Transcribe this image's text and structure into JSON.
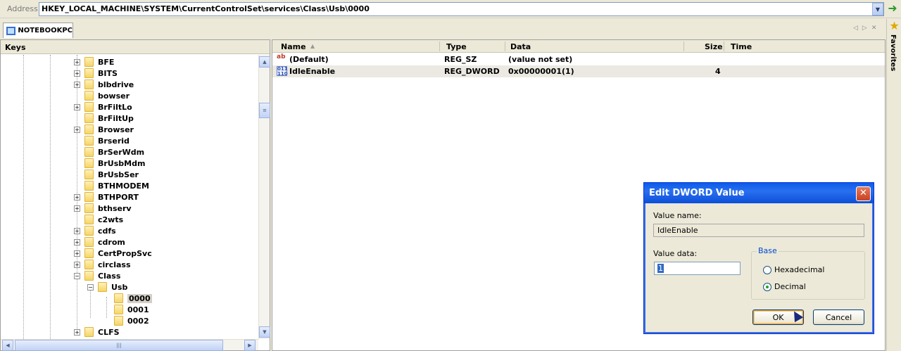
{
  "address": {
    "label": "Address",
    "path": "HKEY_LOCAL_MACHINE\\SYSTEM\\CurrentControlSet\\services\\Class\\Usb\\0000"
  },
  "tab": {
    "label": "NOTEBOOKPC"
  },
  "favorites": {
    "label": "Favorites"
  },
  "keys": {
    "header": "Keys",
    "items": [
      {
        "label": "BFE",
        "expandable": true,
        "level": 0
      },
      {
        "label": "BITS",
        "expandable": true,
        "level": 0
      },
      {
        "label": "blbdrive",
        "expandable": true,
        "level": 0
      },
      {
        "label": "bowser",
        "expandable": false,
        "level": 0
      },
      {
        "label": "BrFiltLo",
        "expandable": true,
        "level": 0
      },
      {
        "label": "BrFiltUp",
        "expandable": false,
        "level": 0
      },
      {
        "label": "Browser",
        "expandable": true,
        "level": 0
      },
      {
        "label": "Brserid",
        "expandable": false,
        "level": 0
      },
      {
        "label": "BrSerWdm",
        "expandable": false,
        "level": 0
      },
      {
        "label": "BrUsbMdm",
        "expandable": false,
        "level": 0
      },
      {
        "label": "BrUsbSer",
        "expandable": false,
        "level": 0
      },
      {
        "label": "BTHMODEM",
        "expandable": false,
        "level": 0
      },
      {
        "label": "BTHPORT",
        "expandable": true,
        "level": 0
      },
      {
        "label": "bthserv",
        "expandable": true,
        "level": 0
      },
      {
        "label": "c2wts",
        "expandable": false,
        "level": 0
      },
      {
        "label": "cdfs",
        "expandable": true,
        "level": 0
      },
      {
        "label": "cdrom",
        "expandable": true,
        "level": 0
      },
      {
        "label": "CertPropSvc",
        "expandable": true,
        "level": 0
      },
      {
        "label": "circlass",
        "expandable": true,
        "level": 0
      },
      {
        "label": "Class",
        "expandable": true,
        "expanded": true,
        "level": 0
      },
      {
        "label": "Usb",
        "expandable": true,
        "expanded": true,
        "level": 1
      },
      {
        "label": "0000",
        "expandable": false,
        "level": 2,
        "selected": true
      },
      {
        "label": "0001",
        "expandable": false,
        "level": 2
      },
      {
        "label": "0002",
        "expandable": false,
        "level": 2
      },
      {
        "label": "CLFS",
        "expandable": true,
        "level": 0
      }
    ]
  },
  "values": {
    "columns": {
      "name": "Name",
      "type": "Type",
      "data": "Data",
      "size": "Size",
      "time": "Time"
    },
    "rows": [
      {
        "icon": "string-value-icon",
        "name": "(Default)",
        "type": "REG_SZ",
        "data": "(value not set)",
        "size": ""
      },
      {
        "icon": "binary-value-icon",
        "name": "IdleEnable",
        "type": "REG_DWORD",
        "data": "0x00000001(1)",
        "size": "4"
      }
    ]
  },
  "dialog": {
    "title": "Edit DWORD Value",
    "value_name_label": "Value name:",
    "value_name": "IdleEnable",
    "value_data_label": "Value data:",
    "value_data": "1",
    "base_label": "Base",
    "hex_label": "Hexadecimal",
    "dec_label": "Decimal",
    "selected_base": "Decimal",
    "ok_label": "OK",
    "cancel_label": "Cancel"
  }
}
